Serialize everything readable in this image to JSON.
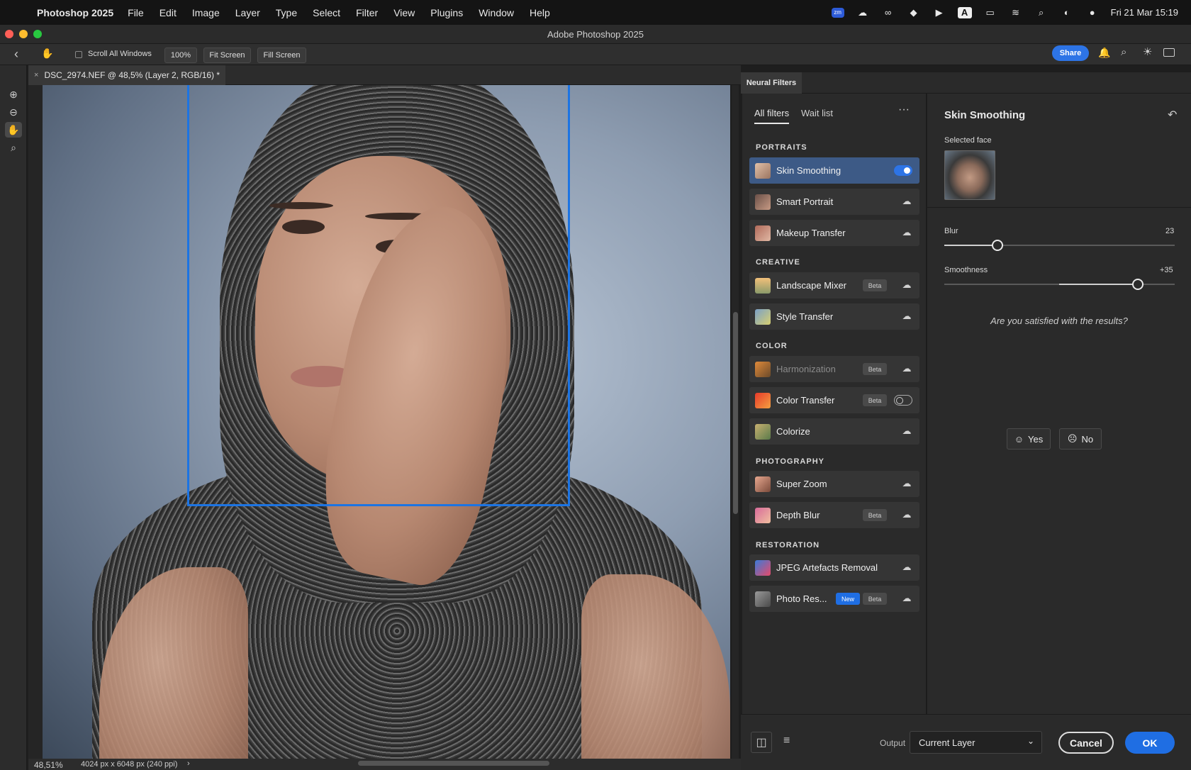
{
  "menubar": {
    "app_name": "Photoshop 2025",
    "items": [
      "File",
      "Edit",
      "Image",
      "Layer",
      "Type",
      "Select",
      "Filter",
      "View",
      "Plugins",
      "Window",
      "Help"
    ],
    "datetime": "Fri 21 Mar  15:19"
  },
  "window": {
    "title": "Adobe Photoshop 2025"
  },
  "options": {
    "scroll_all_windows": "Scroll All Windows",
    "zoom_100": "100%",
    "fit_screen": "Fit Screen",
    "fill_screen": "Fill Screen",
    "share": "Share"
  },
  "document": {
    "tab_title": "DSC_2974.NEF @ 48,5% (Layer 2, RGB/16) *",
    "zoom": "48,51%",
    "info": "4024 px x 6048 px (240 ppi)"
  },
  "neural_filters": {
    "panel_title": "Neural Filters",
    "tabs": {
      "all": "All filters",
      "wait": "Wait list"
    },
    "sections": {
      "portraits": "PORTRAITS",
      "creative": "CREATIVE",
      "color": "COLOR",
      "photography": "PHOTOGRAPHY",
      "restoration": "RESTORATION"
    },
    "filters": [
      {
        "label": "Skin Smoothing"
      },
      {
        "label": "Smart Portrait"
      },
      {
        "label": "Makeup Transfer"
      },
      {
        "label": "Landscape Mixer",
        "badge": "Beta"
      },
      {
        "label": "Style Transfer"
      },
      {
        "label": "Harmonization",
        "badge": "Beta"
      },
      {
        "label": "Color Transfer",
        "badge": "Beta"
      },
      {
        "label": "Colorize"
      },
      {
        "label": "Super Zoom"
      },
      {
        "label": "Depth Blur",
        "badge": "Beta"
      },
      {
        "label": "JPEG Artefacts Removal"
      },
      {
        "label": "Photo Res...",
        "badge_new": "New",
        "badge": "Beta"
      }
    ]
  },
  "settings": {
    "title": "Skin Smoothing",
    "selected_face": "Selected face",
    "blur": {
      "label": "Blur",
      "value": "23",
      "fraction": 0.23
    },
    "smoothness": {
      "label": "Smoothness",
      "value": "+35",
      "fraction": 0.84
    },
    "feedback": "Are you satisfied with the results?",
    "yes": "Yes",
    "no": "No"
  },
  "footer": {
    "output_label": "Output",
    "output_value": "Current Layer",
    "cancel": "Cancel",
    "ok": "OK"
  },
  "colors": {
    "accent": "#2d74e6",
    "face_box": "#1c74e3",
    "active_item": "#3d5a86"
  }
}
